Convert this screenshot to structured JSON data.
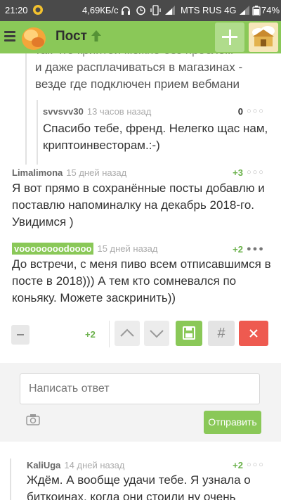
{
  "statusbar": {
    "time": "21:20",
    "speed": "4,69КБ/с",
    "carrier": "MTS RUS 4G",
    "battery": "74%"
  },
  "topbar": {
    "title": "Пост"
  },
  "comments": [
    {
      "text_lines": [
        "и даже расплачиваться в магазинах -",
        "везде где подключен прием вебмани"
      ]
    },
    {
      "author": "svvsvv30",
      "time": "13 часов назад",
      "rating": "0",
      "text": "Спасибо тебе, френд. Нелегко щас нам, криптоинвесторам.:-)"
    },
    {
      "author": "Limalimona",
      "time": "15 дней назад",
      "rating": "+3",
      "text": "Я вот прямо в сохранённые посты добавлю и поставлю напоминалку на декабрь 2018-го. Увидимся )"
    },
    {
      "author": "voooooooodoooo",
      "time": "15 дней назад",
      "rating": "+2",
      "text": "До встречи, с меня пиво всем отписавшимся в посте в 2018))) А тем кто сомневался по коньяку. Можете заскринить))"
    },
    {
      "author": "KaliUga",
      "time": "14 дней назад",
      "rating": "+2",
      "text": "Ждём. А вообще удачи тебе. Я узнала о биткоинах, когда они стоили ну очень"
    }
  ],
  "actions": {
    "rating": "+2",
    "hash": "#"
  },
  "reply": {
    "placeholder": "Написать ответ",
    "send_label": "Отправить"
  },
  "colors": {
    "accent": "#8ac858",
    "danger": "#ee5a50"
  }
}
